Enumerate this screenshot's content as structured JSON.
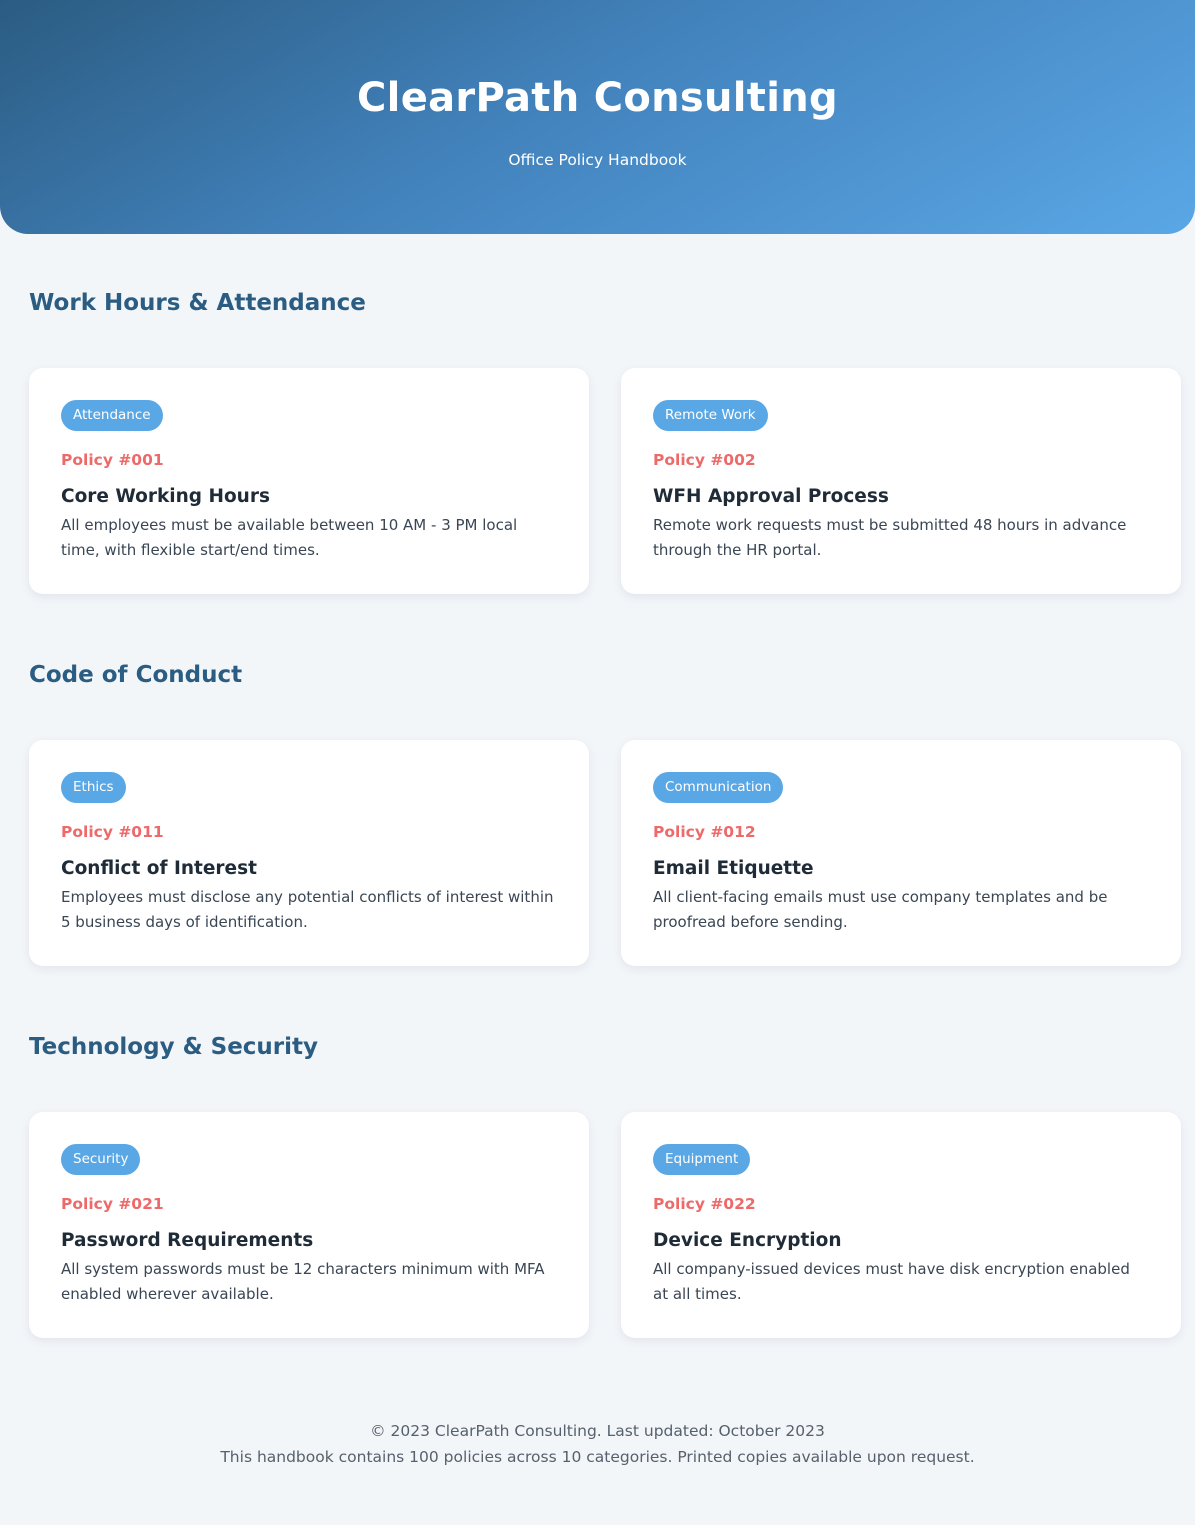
{
  "header": {
    "title": "ClearPath Consulting",
    "subtitle": "Office Policy Handbook"
  },
  "sections": [
    {
      "title": "Work Hours & Attendance",
      "policies": [
        {
          "tag": "Attendance",
          "number": "Policy #001",
          "title": "Core Working Hours",
          "description": "All employees must be available between 10 AM - 3 PM local time, with flexible start/end times."
        },
        {
          "tag": "Remote Work",
          "number": "Policy #002",
          "title": "WFH Approval Process",
          "description": "Remote work requests must be submitted 48 hours in advance through the HR portal."
        }
      ]
    },
    {
      "title": "Code of Conduct",
      "policies": [
        {
          "tag": "Ethics",
          "number": "Policy #011",
          "title": "Conflict of Interest",
          "description": "Employees must disclose any potential conflicts of interest within 5 business days of identification."
        },
        {
          "tag": "Communication",
          "number": "Policy #012",
          "title": "Email Etiquette",
          "description": "All client-facing emails must use company templates and be proofread before sending."
        }
      ]
    },
    {
      "title": "Technology & Security",
      "policies": [
        {
          "tag": "Security",
          "number": "Policy #021",
          "title": "Password Requirements",
          "description": "All system passwords must be 12 characters minimum with MFA enabled wherever available."
        },
        {
          "tag": "Equipment",
          "number": "Policy #022",
          "title": "Device Encryption",
          "description": "All company-issued devices must have disk encryption enabled at all times."
        }
      ]
    }
  ],
  "footer": {
    "line1": "© 2023 ClearPath Consulting. Last updated: October 2023",
    "line2": "This handbook contains 100 policies across 10 categories. Printed copies available upon request."
  },
  "colors": {
    "header_gradient_start": "#2b5c82",
    "header_gradient_end": "#5aa7e6",
    "section_title": "#2b5c82",
    "tag_background": "#5aa7e6",
    "policy_number": "#ee6a6a",
    "page_background": "#f3f6f9"
  }
}
